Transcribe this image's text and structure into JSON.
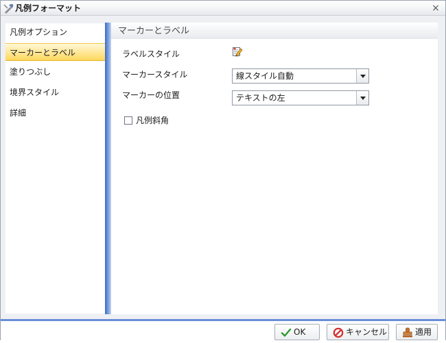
{
  "window": {
    "title": "凡例フォーマット",
    "close_glyph": "×"
  },
  "sidebar": {
    "items": [
      {
        "label": "凡例オプション",
        "selected": false
      },
      {
        "label": "マーカーとラベル",
        "selected": true
      },
      {
        "label": "塗りつぶし",
        "selected": false
      },
      {
        "label": "境界スタイル",
        "selected": false
      },
      {
        "label": "詳細",
        "selected": false
      }
    ]
  },
  "panel": {
    "header": "マーカーとラベル",
    "label_style": {
      "label": "ラベルスタイル",
      "icon": "edit-style-icon"
    },
    "marker_style": {
      "label": "マーカースタイル",
      "value": "線スタイル自動"
    },
    "marker_position": {
      "label": "マーカーの位置",
      "value": "テキストの左"
    },
    "legend_diagonal": {
      "label": "凡例斜角",
      "checked": false
    }
  },
  "footer": {
    "ok_label": "OK",
    "cancel_label": "キャンセル",
    "apply_label": "適用"
  },
  "colors": {
    "selected_nav": "#ffe58f",
    "accent_blue": "#3d6bc0"
  }
}
